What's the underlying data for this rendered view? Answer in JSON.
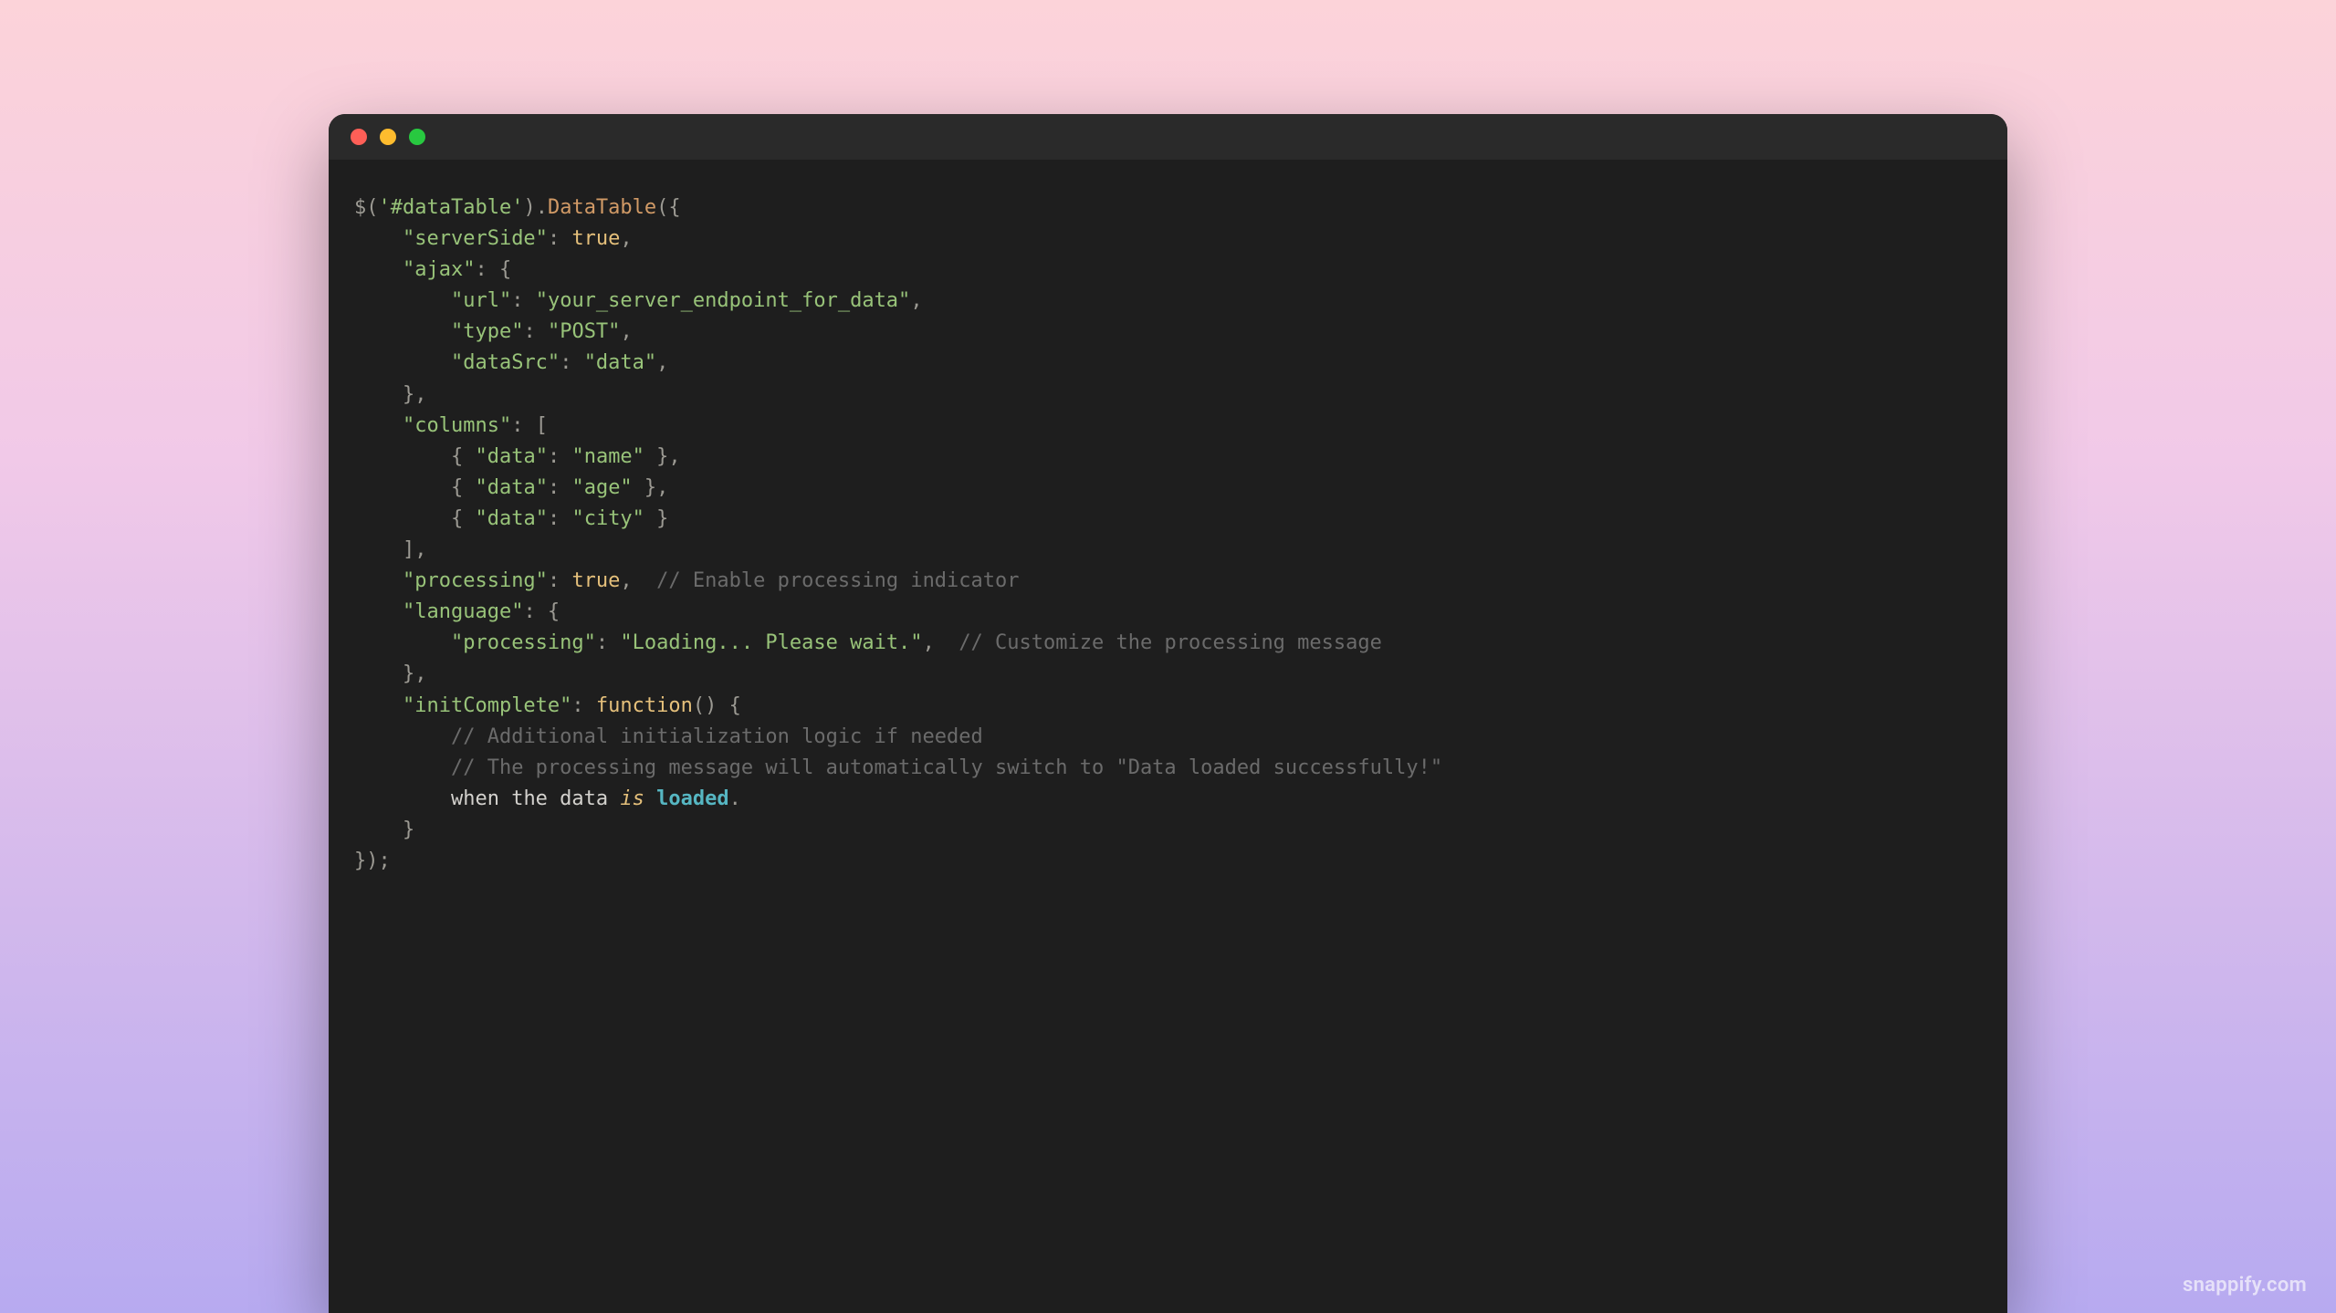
{
  "watermark": "snappify.com",
  "traffic_lights": [
    "red",
    "yellow",
    "green"
  ],
  "code": {
    "jq": "$",
    "selector": "'#dataTable'",
    "method": "DataTable",
    "keys": {
      "serverSide": "\"serverSide\"",
      "ajax": "\"ajax\"",
      "url": "\"url\"",
      "type": "\"type\"",
      "dataSrc": "\"dataSrc\"",
      "columns": "\"columns\"",
      "data": "\"data\"",
      "processing": "\"processing\"",
      "language": "\"language\"",
      "initComplete": "\"initComplete\""
    },
    "vals": {
      "true": "true",
      "urlVal": "\"your_server_endpoint_for_data\"",
      "post": "\"POST\"",
      "dataSrcVal": "\"data\"",
      "name": "\"name\"",
      "age": "\"age\"",
      "city": "\"city\"",
      "loadingMsg": "\"Loading... Please wait.\"",
      "function": "function"
    },
    "comments": {
      "enableProcessing": "// Enable processing indicator",
      "customizeMsg": "// Customize the processing message",
      "additionalInit": "// Additional initialization logic if needed",
      "autoSwitch": "// The processing message will automatically switch to \"Data loaded successfully!\""
    },
    "tailWords": {
      "whenTheData": "when the data ",
      "is": "is",
      "sp": " ",
      "loaded": "loaded",
      "dot": "."
    }
  }
}
